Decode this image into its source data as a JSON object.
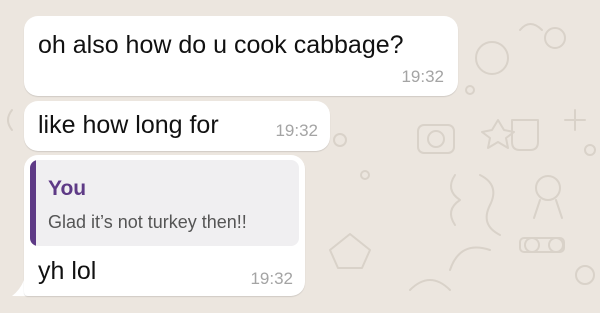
{
  "chat": {
    "messages": [
      {
        "text": "oh also how do u cook cabbage?",
        "time": "19:32"
      },
      {
        "text": "like how long for",
        "time": "19:32"
      },
      {
        "text": "yh lol",
        "time": "19:32",
        "quoted": {
          "author": "You",
          "text": "Glad it’s not turkey then!!"
        }
      }
    ]
  },
  "colors": {
    "chat_background": "#ece6df",
    "bubble": "#ffffff",
    "quote_accent": "#5e3a86",
    "timestamp": "#a4a4a4"
  }
}
